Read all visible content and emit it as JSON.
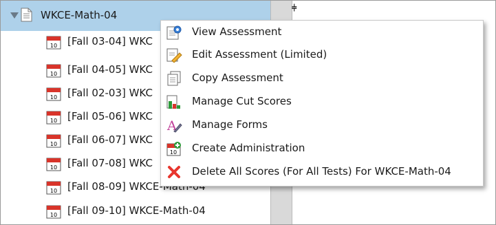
{
  "tree": {
    "root_label": "WKCE-Math-04",
    "items": [
      {
        "label": "[Fall 03-04] WKC"
      },
      {
        "label": "[Fall 04-05] WKC"
      },
      {
        "label": "[Fall 02-03] WKC"
      },
      {
        "label": "[Fall 05-06] WKC"
      },
      {
        "label": "[Fall 06-07] WKC"
      },
      {
        "label": "[Fall 07-08] WKC"
      },
      {
        "label": "[Fall 08-09] WKCE-Math-04"
      },
      {
        "label": "[Fall 09-10] WKCE-Math-04"
      }
    ],
    "item_icon": "calendar-icon"
  },
  "context_menu": {
    "items": [
      {
        "label": "View Assessment",
        "icon": "view-icon"
      },
      {
        "label": "Edit Assessment (Limited)",
        "icon": "edit-icon"
      },
      {
        "label": "Copy Assessment",
        "icon": "copy-icon"
      },
      {
        "label": "Manage Cut Scores",
        "icon": "bar-chart-icon"
      },
      {
        "label": "Manage Forms",
        "icon": "forms-icon"
      },
      {
        "label": "Create Administration",
        "icon": "calendar-add-icon"
      },
      {
        "label": "Delete All Scores (For All Tests) For WKCE-Math-04",
        "icon": "delete-icon"
      }
    ]
  },
  "colors": {
    "selected_row": "#aed1ea",
    "splitter": "#d9d9d9",
    "delete": "#e8362e"
  }
}
